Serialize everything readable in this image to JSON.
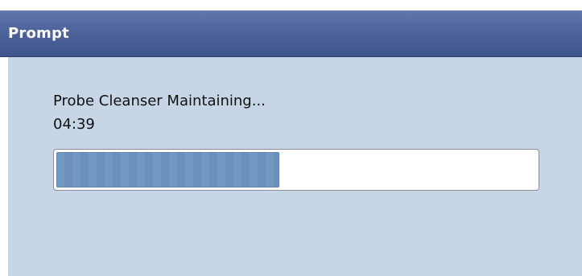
{
  "dialog": {
    "title": "Prompt",
    "message": "Probe Cleanser Maintaining...",
    "timer": "04:39",
    "progress": 0.465,
    "colors": {
      "titlebar": "#4e639c",
      "body_background": "#c6d6e6",
      "progress_fill": "#6d94bf"
    }
  }
}
